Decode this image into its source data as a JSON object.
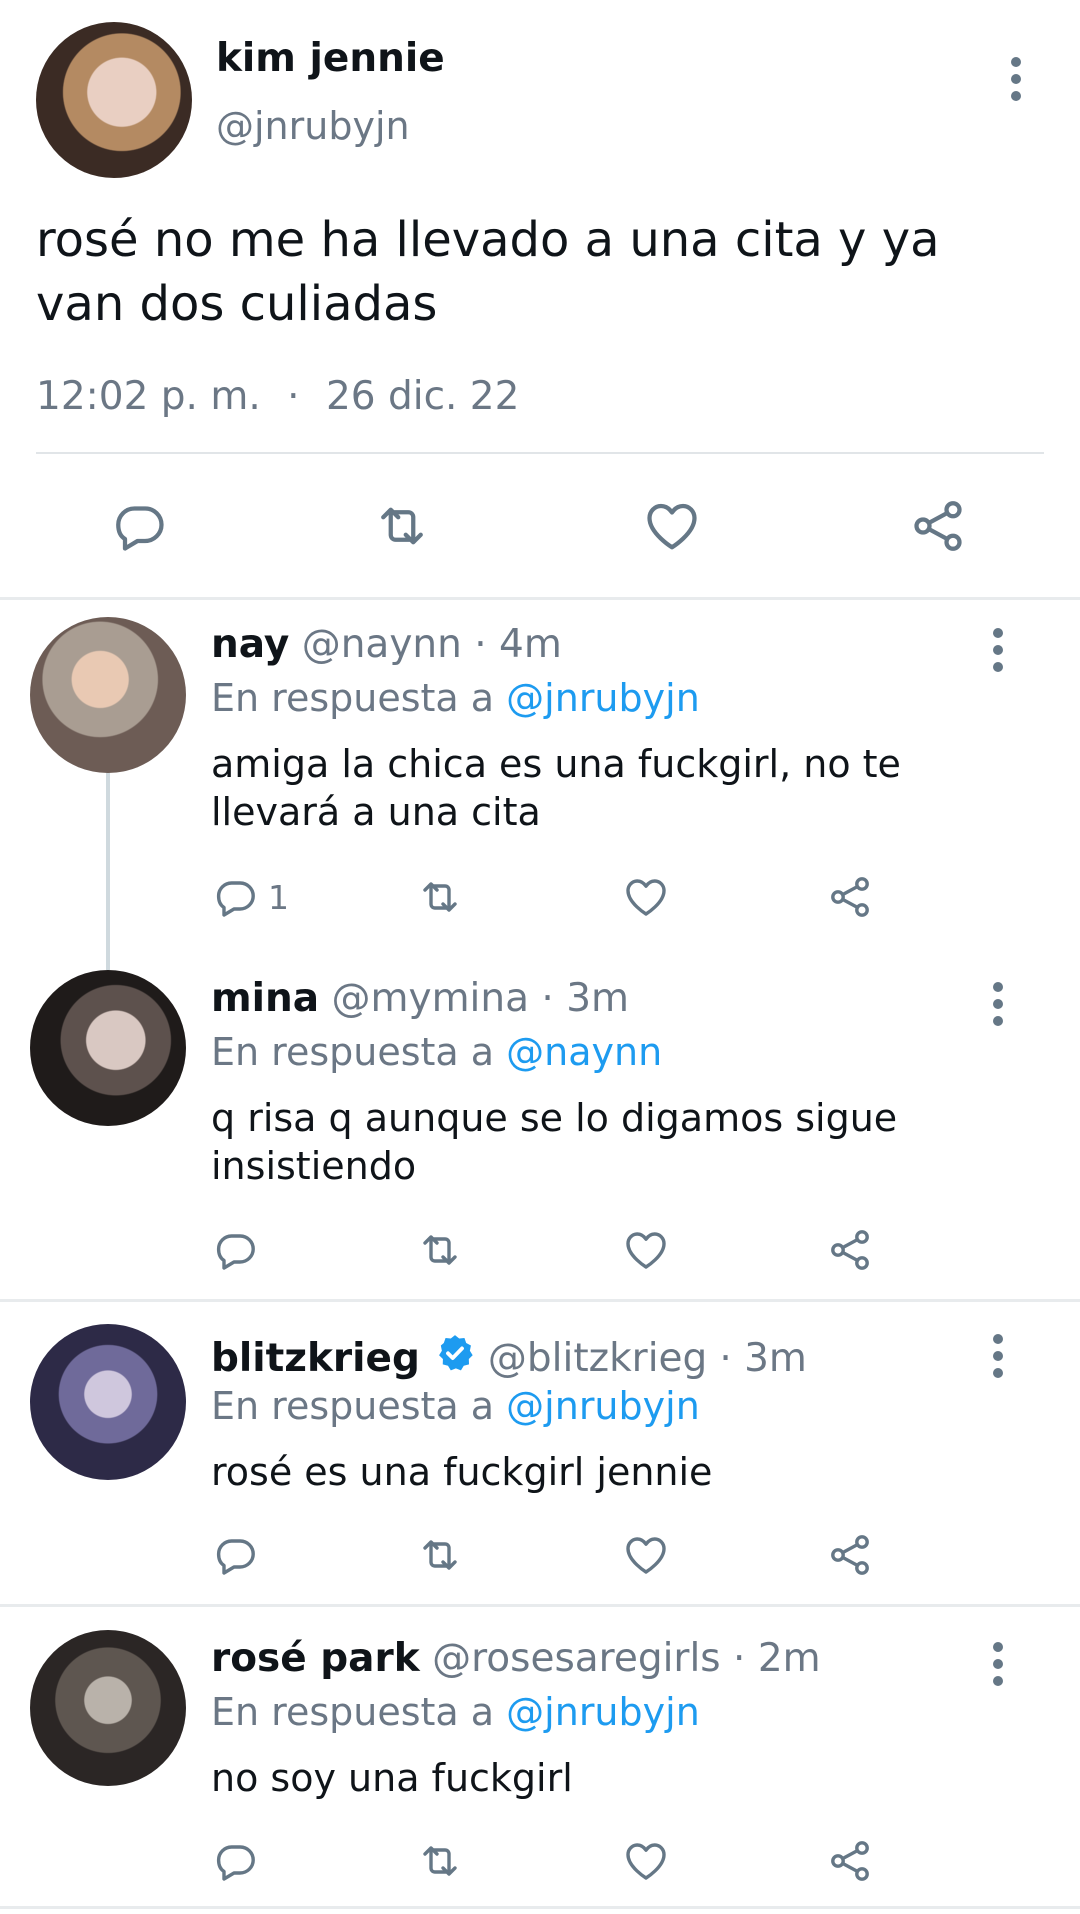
{
  "main_tweet": {
    "display_name": "kim jennie",
    "handle": "@jnrubyjn",
    "text": "rosé no me ha llevado a una cita y ya van dos culiadas",
    "time": "12:02 p. m.",
    "separator": "·",
    "date": "26 dic. 22",
    "actions": [
      "reply-icon",
      "retweet-icon",
      "like-icon",
      "share-icon"
    ]
  },
  "replies": [
    {
      "display_name": "nay",
      "handle": "@naynn",
      "time": "· 4m",
      "reply_prefix": "En respuesta a",
      "reply_to": "@jnrubyjn",
      "text_line1": "amiga la chica es una fuckgirl, no te",
      "text_line2": "llevará a una cita",
      "reply_count": "1"
    },
    {
      "display_name": "mina",
      "handle": "@mymina",
      "time": "· 3m",
      "reply_prefix": "En respuesta a",
      "reply_to": "@naynn",
      "text_line1": "q risa q aunque se lo digamos sigue",
      "text_line2": "insistiendo"
    },
    {
      "display_name": "blitzkrieg",
      "verified": true,
      "handle": "@blitzkrieg",
      "time": "· 3m",
      "reply_prefix": "En respuesta a",
      "reply_to": "@jnrubyjn",
      "text_line1": "rosé es una fuckgirl jennie"
    },
    {
      "display_name": "rosé park",
      "handle": "@rosesaregirls",
      "time": "· 2m",
      "reply_prefix": "En respuesta a",
      "reply_to": "@jnrubyjn",
      "text_line1": "no soy una fuckgirl"
    }
  ],
  "colors": {
    "link": "#1d9bf0",
    "muted": "#6b7785",
    "icon": "#657786",
    "divider": "#e8ebed"
  }
}
